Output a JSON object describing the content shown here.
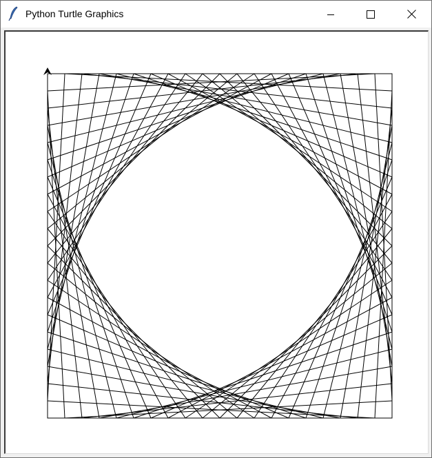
{
  "window": {
    "title": "Python Turtle Graphics",
    "icon": "feather-icon",
    "controls": {
      "minimize_icon": "minimize-icon",
      "maximize_icon": "maximize-icon",
      "close_icon": "close-icon"
    }
  },
  "canvas": {
    "background": "#ffffff",
    "stroke_color": "#000000",
    "turtle_icon": "turtle-arrow-icon"
  }
}
